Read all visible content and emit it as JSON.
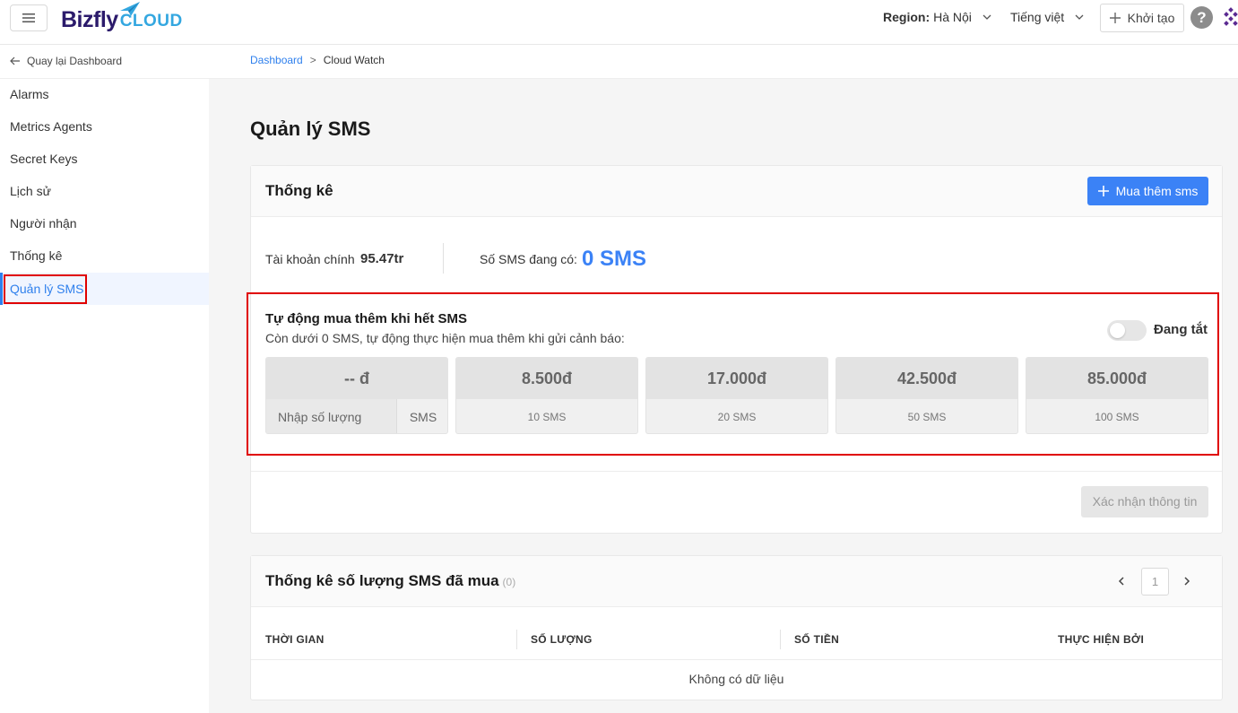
{
  "header": {
    "logo_main": "Bizfly",
    "logo_sub": "CLOUD",
    "region_label": "Region:",
    "region_value": "Hà Nội",
    "language": "Tiếng việt",
    "create_label": "Khởi tạo",
    "help_glyph": "?"
  },
  "sidebar": {
    "back_label": "Quay lại Dashboard",
    "items": [
      {
        "label": "Alarms"
      },
      {
        "label": "Metrics Agents"
      },
      {
        "label": "Secret Keys"
      },
      {
        "label": "Lịch sử"
      },
      {
        "label": "Người nhận"
      },
      {
        "label": "Thống kê"
      },
      {
        "label": "Quản lý SMS"
      }
    ],
    "active_index": 6
  },
  "breadcrumb": {
    "root": "Dashboard",
    "separator": ">",
    "current": "Cloud Watch"
  },
  "page": {
    "title": "Quản lý SMS"
  },
  "stats_card": {
    "title": "Thống kê",
    "buy_button": "Mua thêm sms",
    "account_label": "Tài khoản chính",
    "account_value": "95.47tr",
    "sms_label": "Số SMS đang có:",
    "sms_value": "0 SMS"
  },
  "auto_buy": {
    "title": "Tự động mua thêm khi hết SMS",
    "description": "Còn dưới 0 SMS, tự động thực hiện mua thêm khi gửi cảnh báo:",
    "toggle_state": "Đang tắt",
    "toggle_on": false,
    "custom": {
      "price": "-- đ",
      "input_placeholder": "Nhập số lượng",
      "unit": "SMS"
    },
    "packages": [
      {
        "price": "8.500đ",
        "qty": "10 SMS"
      },
      {
        "price": "17.000đ",
        "qty": "20 SMS"
      },
      {
        "price": "42.500đ",
        "qty": "50 SMS"
      },
      {
        "price": "85.000đ",
        "qty": "100 SMS"
      }
    ],
    "confirm_button": "Xác nhận thông tin"
  },
  "history_card": {
    "title": "Thống kê số lượng SMS đã mua",
    "count": "(0)",
    "page": "1",
    "columns": [
      "THỜI GIAN",
      "SỐ LƯỢNG",
      "SỐ TIỀN",
      "THỰC HIỆN BỞI"
    ],
    "empty_text": "Không có dữ liệu"
  },
  "colors": {
    "accent": "#3b82f6",
    "highlight_box": "#e00000",
    "logo_dark": "#2b1a6b",
    "logo_light": "#34a7e0"
  }
}
